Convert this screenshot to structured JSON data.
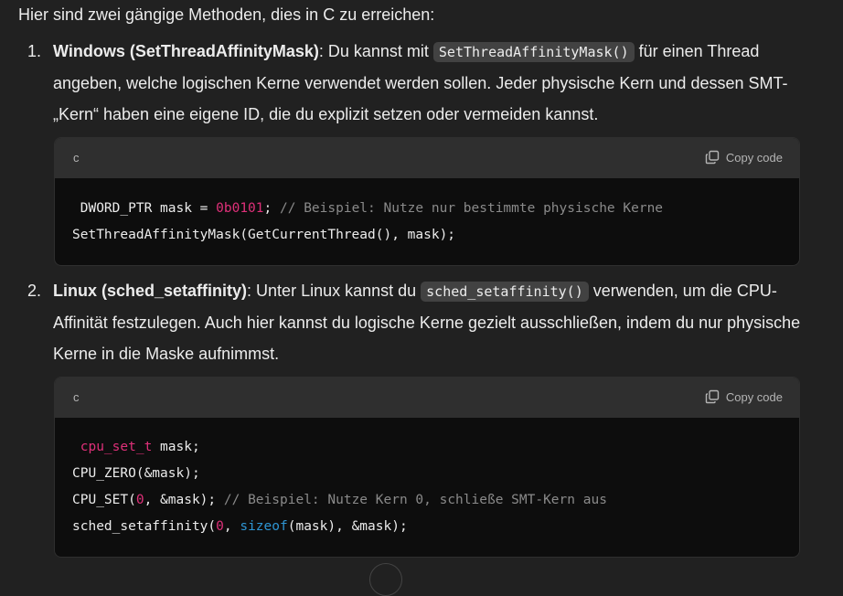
{
  "intro": "Hier sind zwei gängige Methoden, dies in C zu erreichen:",
  "items": [
    {
      "num": "1.",
      "title": "Windows (SetThreadAffinityMask)",
      "t1": ": Du kannst mit ",
      "code": "SetThreadAffinityMask()",
      "t2": " für einen Thread angeben, welche logischen Kerne verwendet werden sollen. Jeder physische Kern und dessen SMT-„Kern“ haben eine eigene ID, die du explizit setzen oder vermeiden kannst."
    },
    {
      "num": "2.",
      "title": "Linux (sched_setaffinity)",
      "t1": ": Unter Linux kannst du ",
      "code": "sched_setaffinity()",
      "t2": " verwenden, um die CPU-Affinität festzulegen. Auch hier kannst du logische Kerne gezielt ausschließen, indem du nur physische Kerne in die Maske aufnimmst."
    }
  ],
  "codeblocks": [
    {
      "lang": "c",
      "copy_label": "Copy code",
      "l1_a": "DWORD_PTR mask = ",
      "l1_num": "0b0101",
      "l1_b": "; ",
      "l1_comment": "// Beispiel: Nutze nur bestimmte physische Kerne",
      "l2": "SetThreadAffinityMask(GetCurrentThread(), mask);"
    },
    {
      "lang": "c",
      "copy_label": "Copy code",
      "l1_type": "cpu_set_t",
      "l1_b": " mask;",
      "l2": "CPU_ZERO(&mask);",
      "l3_a": "CPU_SET(",
      "l3_num": "0",
      "l3_b": ", &mask); ",
      "l3_comment": "// Beispiel: Nutze Kern 0, schließe SMT-Kern aus",
      "l4_a": "sched_setaffinity(",
      "l4_num": "0",
      "l4_b": ", ",
      "l4_kw": "sizeof",
      "l4_c": "(mask), &mask);"
    }
  ]
}
